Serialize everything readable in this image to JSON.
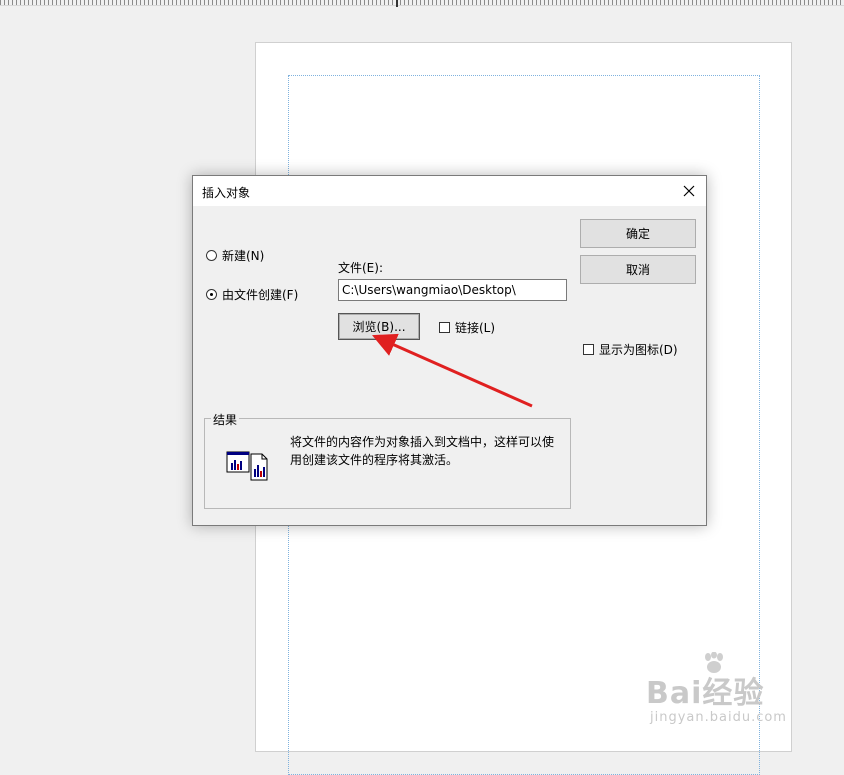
{
  "dialog": {
    "title": "插入对象",
    "options": {
      "create_new": "新建(N)",
      "create_from_file": "由文件创建(F)",
      "selected": "create_from_file"
    },
    "file": {
      "label": "文件(E):",
      "value": "C:\\Users\\wangmiao\\Desktop\\"
    },
    "browse_label": "浏览(B)...",
    "link_label": "链接(L)",
    "link_checked": false,
    "display_as_icon_label": "显示为图标(D)",
    "display_as_icon_checked": false,
    "ok_label": "确定",
    "cancel_label": "取消",
    "result": {
      "label": "结果",
      "text": "将文件的内容作为对象插入到文档中，这样可以使用创建该文件的程序将其激活。"
    }
  },
  "annotation": {
    "arrow_color": "#e02020"
  },
  "watermark": {
    "logo": "Bai经验",
    "url": "jingyan.baidu.com"
  }
}
